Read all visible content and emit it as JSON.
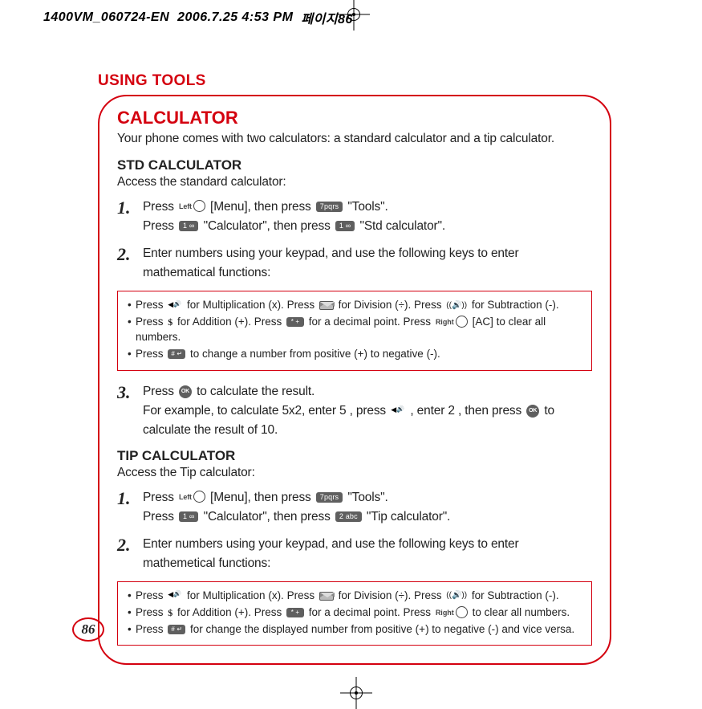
{
  "meta": {
    "doc_id": "1400VM_060724-EN",
    "timestamp": "2006.7.25 4:53 PM",
    "crop_marks_label": "페이지86"
  },
  "chapter_title": "USING TOOLS",
  "section_title": "CALCULATOR",
  "intro": "Your phone comes with two calculators: a standard calculator and a tip calculator.",
  "std": {
    "heading": "STD CALCULATOR",
    "lead": "Access the standard calculator:",
    "steps": [
      {
        "num": "1.",
        "line1_a": "Press ",
        "left_label": "Left",
        "line1_b": " [Menu], then press ",
        "key7": "7pqrs",
        "line1_c": " \"Tools\".",
        "line2_a": "Press ",
        "key1a": "1 ∞",
        "line2_b": " \"Calculator\", then press ",
        "key1b": "1 ∞",
        "line2_c": " \"Std calculator\"."
      },
      {
        "num": "2.",
        "text": "Enter numbers using your keypad, and use the following keys to enter mathematical functions:"
      },
      {
        "num": "3.",
        "line1_a": "Press ",
        "ok": "OK",
        "line1_b": " to calculate the result.",
        "line2_a": "For example, to calculate 5x2, enter 5 , press ",
        "speaker_label": "◀🔊",
        "line2_b": " , enter 2 , then press ",
        "line2_c": " to calculate the result of 10."
      }
    ],
    "note": {
      "r1_a": "Press ",
      "r1_b": " for Multiplication (x).  Press ",
      "r1_c": " for Division (÷).  Press ",
      "r1_d": " for Subtraction (-).",
      "r2_a": "Press ",
      "r2_b": " for Addition (+).  Press ",
      "r2_c": " for a decimal point.  Press ",
      "right_label": "Right",
      "r2_d": " [AC] to clear all numbers.",
      "r3_a": "Press ",
      "r3_b": " to change a number from positive (+) to negative (-).",
      "key_star": "* +",
      "key_hash": "# ↵"
    }
  },
  "tip": {
    "heading": "TIP CALCULATOR",
    "lead": "Access the Tip calculator:",
    "steps": [
      {
        "num": "1.",
        "line1_a": "Press ",
        "left_label": "Left",
        "line1_b": " [Menu], then press ",
        "key7": "7pqrs",
        "line1_c": " \"Tools\".",
        "line2_a": "Press ",
        "key1": "1 ∞",
        "line2_b": " \"Calculator\", then press ",
        "key2": "2 abc",
        "line2_c": " \"Tip calculator\"."
      },
      {
        "num": "2.",
        "text": "Enter numbers using your keypad, and use the following keys to enter mathemetical functions:"
      }
    ],
    "note": {
      "r1_a": "Press ",
      "r1_b": " for Multiplication (x).  Press ",
      "r1_c": " for Division (÷).  Press ",
      "r1_d": " for Subtraction (-).",
      "r2_a": "Press ",
      "r2_b": " for Addition (+).  Press ",
      "r2_c": " for a decimal point.  Press ",
      "right_label": "Right",
      "r2_d": " to clear all numbers.",
      "r3_a": "Press ",
      "r3_b": " for change the displayed number from positive (+) to negative (-) and vice versa.",
      "key_star": "* +",
      "key_hash": "# ↵"
    }
  },
  "page_number": "86"
}
